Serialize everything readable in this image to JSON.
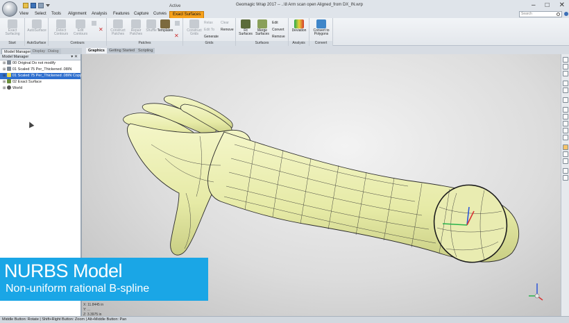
{
  "titlebar": {
    "window_title": "Geomagic Wrap 2017 -- ..\\8 Arm scan open Aligned_from DX_IN.wrp",
    "context_group_label": "Active",
    "minimize": "–",
    "maximize": "□",
    "close": "✕"
  },
  "tabs": [
    "View",
    "Select",
    "Tools",
    "Alignment",
    "Analysis",
    "Features",
    "Capture",
    "Curves",
    "Exact Surfaces"
  ],
  "search": {
    "placeholder": "Search"
  },
  "ribbon": {
    "groups": [
      "Start",
      "AutoSurface",
      "Contours",
      "Patches",
      "Grids",
      "Surfaces",
      "Analysis",
      "Convert"
    ],
    "buttons": {
      "exact_surfacing": "Exact\nSurfacing",
      "autosurface": "AutoSurface",
      "detect_contours": "Detect\nContours",
      "edit_contours": "Edit\nContours",
      "construct_patches": "Construct\nPatches",
      "repair_patches": "Repair\nPatches",
      "shuffle": "Shuffle",
      "templates": "Templates",
      "construct_grids": "Construct\nGrids",
      "relax": "Relax",
      "edit": "Edit To",
      "generate": "Generate",
      "clear": "Clear",
      "remove_grids": "Remove",
      "fit_surfaces": "Fit\nSurfaces",
      "merge_surfaces": "Merge\nSurfaces",
      "edit_surfaces": "Edit",
      "convert": "Convert",
      "remove_surfaces": "Remove",
      "deviation": "Deviation",
      "convert_to_polygons": "Convert to\nPolygons"
    }
  },
  "panel": {
    "tabs": [
      "Model Manager",
      "Display",
      "Dialog"
    ],
    "title": "Model Manager",
    "items": [
      {
        "label": "00 Original Do not modify",
        "selected": false
      },
      {
        "label": "01 Scaled 75 Per_Thickened .08IN",
        "selected": false
      },
      {
        "label": "01 Scaled 75 Per_Thickened .08IN Copy",
        "selected": true
      },
      {
        "label": "02 Exact Surface",
        "selected": false
      },
      {
        "label": "World",
        "selected": false
      }
    ]
  },
  "viewport": {
    "tabs": [
      "Graphics",
      "Getting Started",
      "Scripting"
    ],
    "coords": [
      "X: 11.8445 in",
      "Y: ...",
      "Z: 3.3975 in"
    ]
  },
  "banner": {
    "title": "NURBS Model",
    "subtitle": "Non-uniform rational B-spline",
    "color": "#1aa6e6"
  },
  "statusbar": {
    "text": "Middle Button: Rotate | Shift+Right Button: Zoom | Alt+Middle Button: Pan"
  },
  "colors": {
    "accent_tab": "#f6a11c",
    "selection": "#2f6fce",
    "model_fill": "#eef1b4"
  }
}
